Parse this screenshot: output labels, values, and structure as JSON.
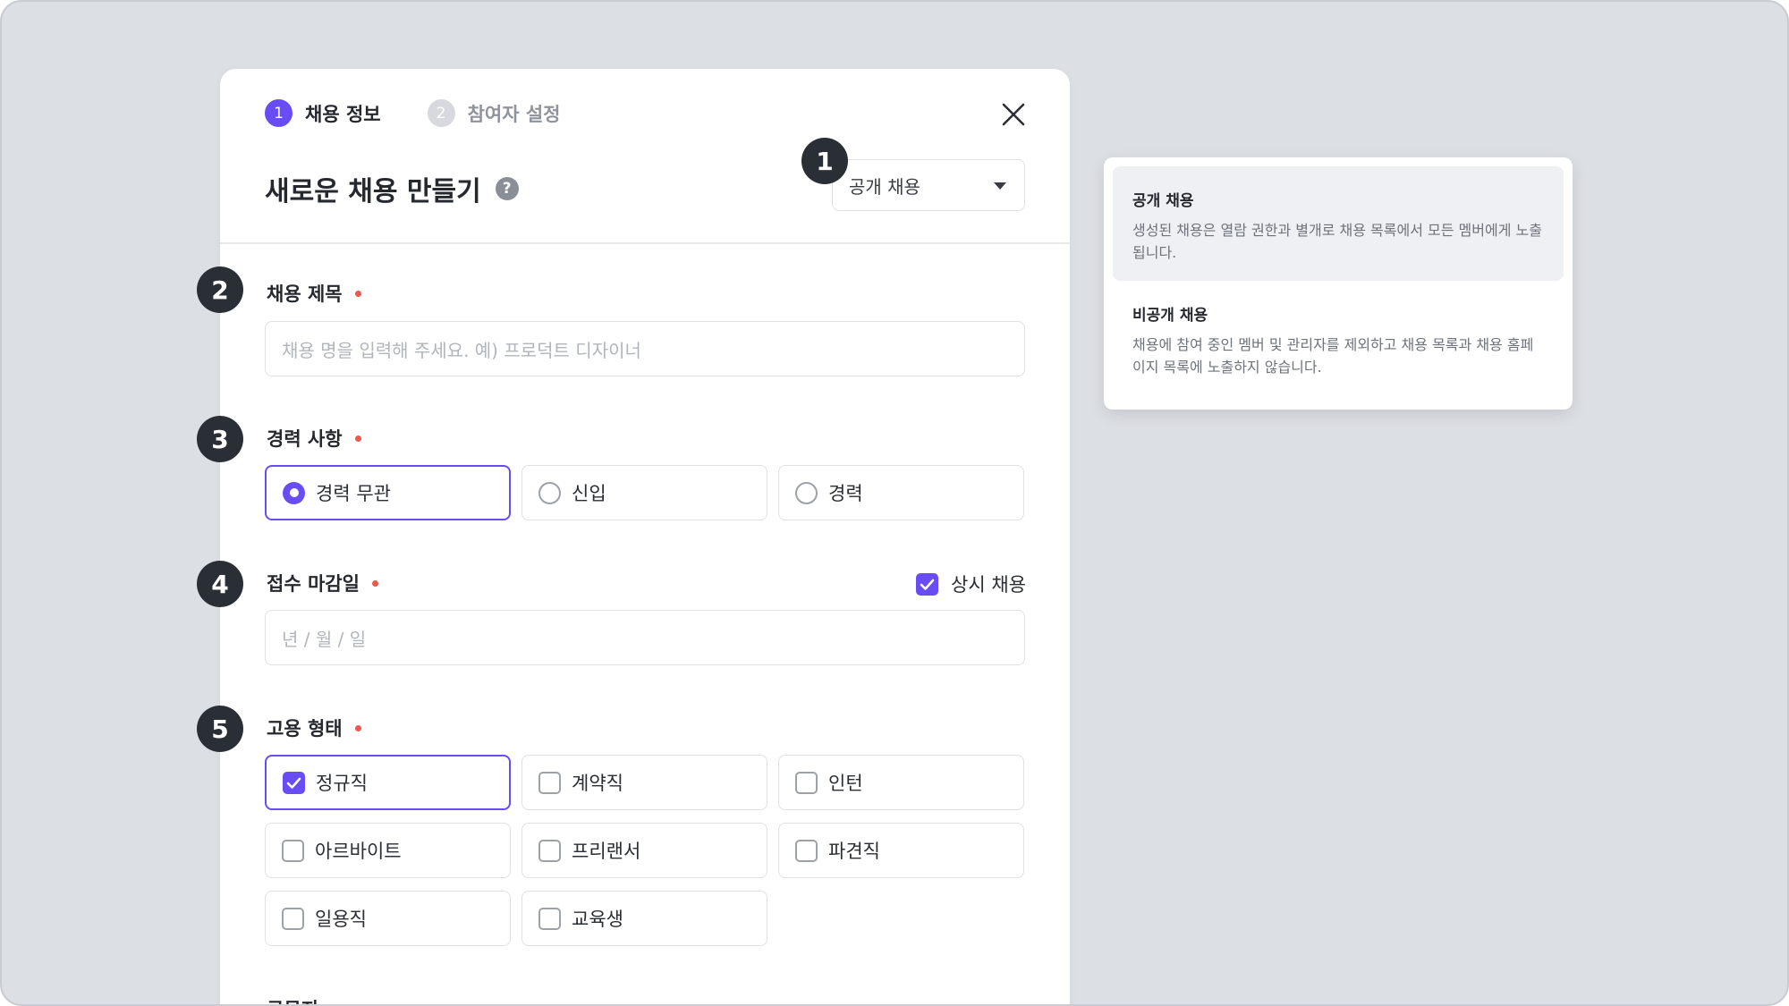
{
  "modal": {
    "steps": [
      {
        "num": "1",
        "label": "채용 정보"
      },
      {
        "num": "2",
        "label": "참여자 설정"
      }
    ],
    "title": "새로운 채용 만들기",
    "help_glyph": "?",
    "visibility_select": {
      "value": "공개 채용"
    },
    "fields": {
      "job_title": {
        "label": "채용 제목",
        "placeholder": "채용 명을 입력해 주세요. 예) 프로덕트 디자이너"
      },
      "experience": {
        "label": "경력 사항",
        "options": [
          "경력 무관",
          "신입",
          "경력"
        ],
        "selected": "경력 무관"
      },
      "deadline": {
        "label": "접수 마감일",
        "placeholder": "년 / 월 / 일",
        "always_label": "상시 채용",
        "always_checked": true
      },
      "employment_type": {
        "label": "고용 형태",
        "options": [
          "정규직",
          "계약직",
          "인턴",
          "아르바이트",
          "프리랜서",
          "파견직",
          "일용직",
          "교육생"
        ],
        "checked": [
          "정규직"
        ]
      },
      "next_label": "근무지"
    }
  },
  "annotations": [
    "1",
    "2",
    "3",
    "4",
    "5"
  ],
  "dropdown": {
    "items": [
      {
        "title": "공개 채용",
        "desc": "생성된 채용은 열람 권한과 별개로 채용 목록에서 모든 멤버에게 노출됩니다."
      },
      {
        "title": "비공개 채용",
        "desc": "채용에 참여 중인 멤버 및 관리자를 제외하고 채용 목록과 채용 홈페이지 목록에 노출하지 않습니다."
      }
    ]
  },
  "colors": {
    "accent": "#6a4cf5",
    "required": "#f0564b",
    "badge": "#2a2f36",
    "background": "#dcdfe4"
  }
}
